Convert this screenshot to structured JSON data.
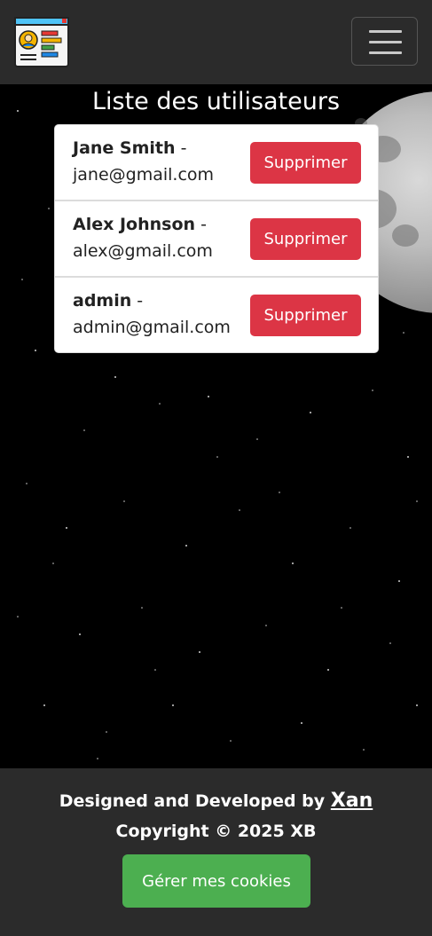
{
  "navbar": {
    "logo_icon": "user-profile-app-icon",
    "toggler_icon": "hamburger-menu-icon"
  },
  "main": {
    "title": "Liste des utilisateurs",
    "users": [
      {
        "name": "Jane Smith",
        "separator": " -",
        "email": "jane@gmail.com",
        "delete_label": "Supprimer"
      },
      {
        "name": "Alex Johnson",
        "separator": " -",
        "email": "alex@gmail.com",
        "delete_label": "Supprimer"
      },
      {
        "name": "admin",
        "separator": " -",
        "email": "admin@gmail.com",
        "delete_label": "Supprimer"
      }
    ]
  },
  "footer": {
    "designed_text": "Designed and Developed by ",
    "author_link": "Xan",
    "copyright": "Copyright © 2025 XB",
    "cookies_button": "Gérer mes cookies"
  },
  "colors": {
    "navbar_bg": "#2b2b2b",
    "delete_button": "#dc3545",
    "cookies_button": "#4caf50"
  }
}
